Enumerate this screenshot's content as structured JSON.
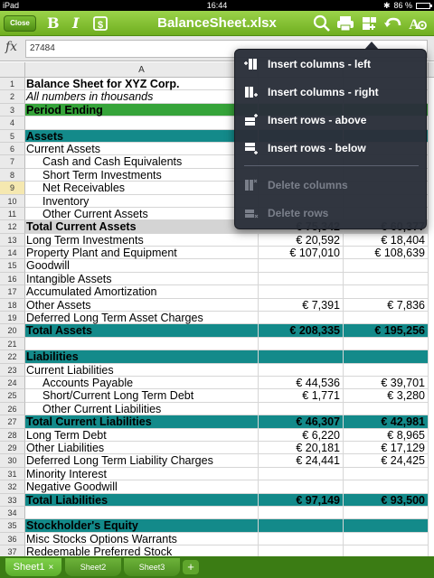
{
  "status": {
    "carrier": "iPad",
    "time": "16:44",
    "battery": "86 %",
    "battery_level": 0.86
  },
  "toolbar": {
    "close_label": "Close",
    "bold_label": "B",
    "italic_label": "I",
    "title": "BalanceSheet.xlsx"
  },
  "formula": {
    "fx_label": "fx",
    "value": "27484"
  },
  "grid": {
    "column_headers": [
      "A",
      "",
      ""
    ],
    "rows": [
      {
        "n": "1",
        "a": "Balance Sheet for XYZ Corp.",
        "b": "",
        "c": "",
        "style": "bold"
      },
      {
        "n": "2",
        "a": "All numbers in thousands",
        "b": "",
        "c": "",
        "style": "italic"
      },
      {
        "n": "3",
        "a": "Period Ending",
        "b": "",
        "c": "",
        "style": "green"
      },
      {
        "n": "4",
        "a": "",
        "b": "",
        "c": "",
        "style": ""
      },
      {
        "n": "5",
        "a": "Assets",
        "b": "",
        "c": "",
        "style": "teal"
      },
      {
        "n": "6",
        "a": "Current Assets",
        "b": "",
        "c": "",
        "style": ""
      },
      {
        "n": "7",
        "a": "Cash and Cash Equivalents",
        "b": "",
        "c": "",
        "style": "indent"
      },
      {
        "n": "8",
        "a": "Short Term Investments",
        "b": "",
        "c": "",
        "style": "indent"
      },
      {
        "n": "9",
        "a": "Net Receivables",
        "b": "",
        "c": "",
        "style": "indent selected"
      },
      {
        "n": "10",
        "a": "Inventory",
        "b": "",
        "c": "",
        "style": "indent"
      },
      {
        "n": "11",
        "a": "Other Current Assets",
        "b": "",
        "c": "",
        "style": "indent"
      },
      {
        "n": "12",
        "a": "Total Current Assets",
        "b": "€ 75,342",
        "c": "€ 60,377",
        "style": "gray"
      },
      {
        "n": "13",
        "a": "Long Term Investments",
        "b": "€ 20,592",
        "c": "€ 18,404",
        "style": ""
      },
      {
        "n": "14",
        "a": "Property Plant and Equipment",
        "b": "€ 107,010",
        "c": "€ 108,639",
        "style": ""
      },
      {
        "n": "15",
        "a": "Goodwill",
        "b": "",
        "c": "",
        "style": ""
      },
      {
        "n": "16",
        "a": "Intangible Assets",
        "b": "",
        "c": "",
        "style": ""
      },
      {
        "n": "17",
        "a": "Accumulated Amortization",
        "b": "",
        "c": "",
        "style": ""
      },
      {
        "n": "18",
        "a": "Other Assets",
        "b": "€ 7,391",
        "c": "€ 7,836",
        "style": ""
      },
      {
        "n": "19",
        "a": "Deferred Long Term Asset Charges",
        "b": "",
        "c": "",
        "style": ""
      },
      {
        "n": "20",
        "a": "Total Assets",
        "b": "€ 208,335",
        "c": "€ 195,256",
        "style": "teal"
      },
      {
        "n": "21",
        "a": "",
        "b": "",
        "c": "",
        "style": ""
      },
      {
        "n": "22",
        "a": "Liabilities",
        "b": "",
        "c": "",
        "style": "teal"
      },
      {
        "n": "23",
        "a": "Current Liabilities",
        "b": "",
        "c": "",
        "style": ""
      },
      {
        "n": "24",
        "a": "Accounts Payable",
        "b": "€ 44,536",
        "c": "€ 39,701",
        "style": "indent"
      },
      {
        "n": "25",
        "a": "Short/Current Long Term Debt",
        "b": "€ 1,771",
        "c": "€ 3,280",
        "style": "indent"
      },
      {
        "n": "26",
        "a": "Other Current Liabilities",
        "b": "",
        "c": "",
        "style": "indent"
      },
      {
        "n": "27",
        "a": "Total Current Liabilities",
        "b": "€ 46,307",
        "c": "€ 42,981",
        "style": "teal"
      },
      {
        "n": "28",
        "a": "Long Term Debt",
        "b": "€ 6,220",
        "c": "€ 8,965",
        "style": ""
      },
      {
        "n": "29",
        "a": "Other Liabilities",
        "b": "€ 20,181",
        "c": "€ 17,129",
        "style": ""
      },
      {
        "n": "30",
        "a": "Deferred Long Term Liability Charges",
        "b": "€ 24,441",
        "c": "€ 24,425",
        "style": ""
      },
      {
        "n": "31",
        "a": "Minority Interest",
        "b": "",
        "c": "",
        "style": ""
      },
      {
        "n": "32",
        "a": "Negative Goodwill",
        "b": "",
        "c": "",
        "style": ""
      },
      {
        "n": "33",
        "a": "Total Liabilities",
        "b": "€ 97,149",
        "c": "€ 93,500",
        "style": "teal"
      },
      {
        "n": "34",
        "a": "",
        "b": "",
        "c": "",
        "style": ""
      },
      {
        "n": "35",
        "a": "Stockholder's Equity",
        "b": "",
        "c": "",
        "style": "teal"
      },
      {
        "n": "36",
        "a": "Misc Stocks Options Warrants",
        "b": "",
        "c": "",
        "style": ""
      },
      {
        "n": "37",
        "a": "Redeemable Preferred Stock",
        "b": "",
        "c": "",
        "style": ""
      }
    ]
  },
  "popover": {
    "items": [
      {
        "label": "Insert columns - left",
        "enabled": true,
        "icon": "insert-columns-left-icon"
      },
      {
        "label": "Insert columns - right",
        "enabled": true,
        "icon": "insert-columns-right-icon"
      },
      {
        "label": "Insert rows - above",
        "enabled": true,
        "icon": "insert-rows-above-icon"
      },
      {
        "label": "Insert rows - below",
        "enabled": true,
        "icon": "insert-rows-below-icon"
      },
      {
        "label": "Delete columns",
        "enabled": false,
        "icon": "delete-columns-icon"
      },
      {
        "label": "Delete rows",
        "enabled": false,
        "icon": "delete-rows-icon"
      }
    ]
  },
  "tabs": [
    {
      "label": "Sheet1",
      "active": true,
      "close": "×"
    },
    {
      "label": "Sheet2",
      "active": false
    },
    {
      "label": "Sheet3",
      "active": false
    }
  ],
  "tab_add_label": "+",
  "colors": {
    "toolbar": "#7cc034",
    "section_teal": "#138a8a",
    "period_green": "#36a43a",
    "popover": "#2a2f3a"
  }
}
